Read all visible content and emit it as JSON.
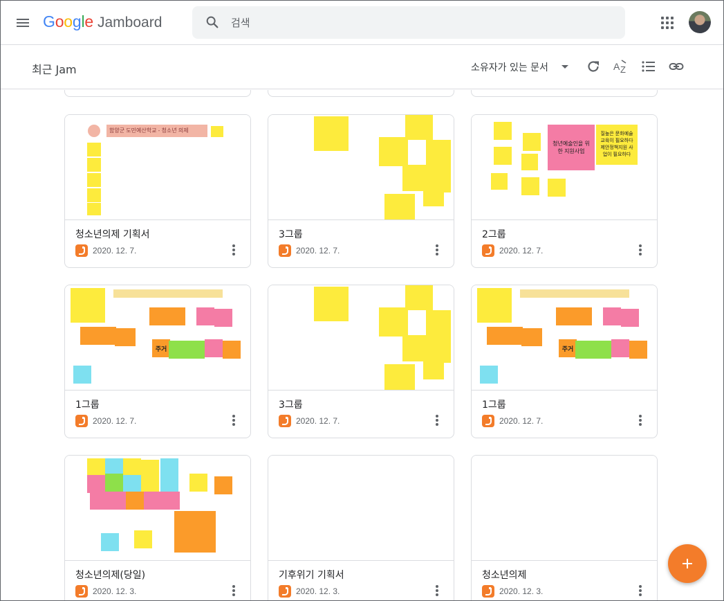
{
  "app": {
    "logo": "Google",
    "product": "Jamboard"
  },
  "search": {
    "placeholder": "검색"
  },
  "subbar": {
    "title": "최근 Jam",
    "owner_filter": "소유자가 있는 문서"
  },
  "cards": [
    {
      "name": "청소년의제 기획서",
      "date": "2020. 12. 7.",
      "thumb_title": "함양군 도민예산학교 - 청소년 의제"
    },
    {
      "name": "3그룹",
      "date": "2020. 12. 7."
    },
    {
      "name": "2그룹",
      "date": "2020. 12. 7.",
      "note_pink": "청년예술인을 위한 지원사업",
      "note_yellow": "질높은 문화예술 교육이 필요하다 제안정책지원 사업이 필요하다"
    },
    {
      "name": "1그룹",
      "date": "2020. 12. 7.",
      "note_orange": "주거"
    },
    {
      "name": "3그룹",
      "date": "2020. 12. 7."
    },
    {
      "name": "1그룹",
      "date": "2020. 12. 7.",
      "note_orange": "주거"
    },
    {
      "name": "청소년의제(당일)",
      "date": "2020. 12. 3."
    },
    {
      "name": "기후위기 기획서",
      "date": "2020. 12. 3."
    },
    {
      "name": "청소년의제",
      "date": "2020. 12. 3."
    }
  ],
  "colors": {
    "accent": "#f37c2a",
    "sticky_yellow": "#fdeb3d",
    "sticky_pink": "#f47ca5",
    "sticky_orange": "#fb9b2a",
    "sticky_green": "#8ee04a",
    "sticky_cyan": "#7ee0f0"
  }
}
